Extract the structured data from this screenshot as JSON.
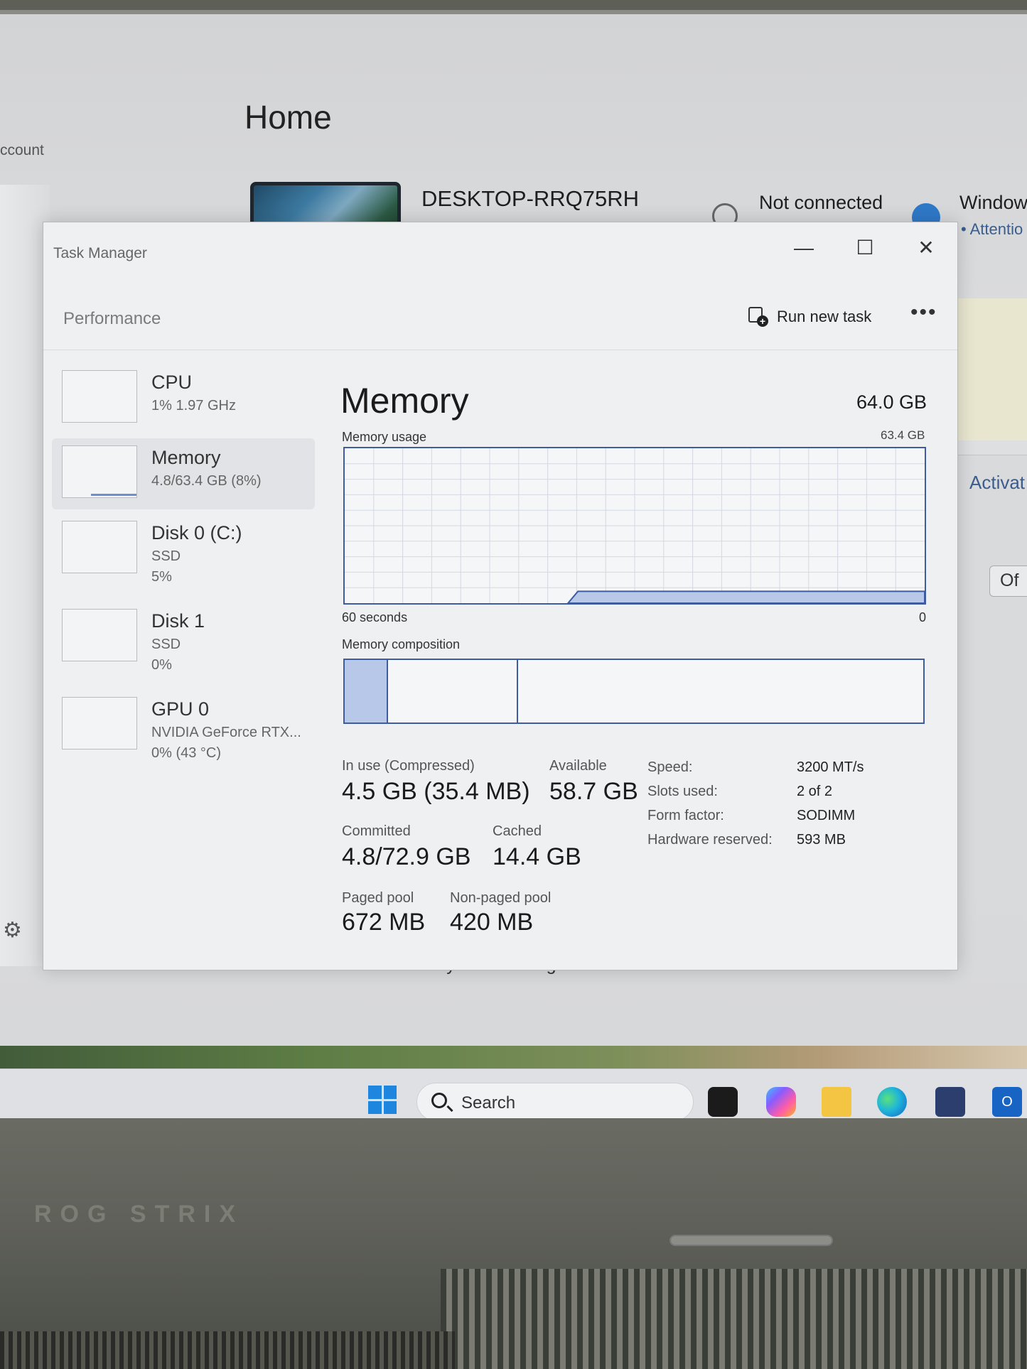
{
  "settings": {
    "title": "Home",
    "account_label": "ccount",
    "pc_name": "DESKTOP-RRQ75RH",
    "network_status": "Not connected",
    "windows_label": "Window",
    "attention_label": "• Attentio",
    "activate_label": "Activat",
    "off_label": "Of",
    "recent_label": "Recent and commonly used settings"
  },
  "task_manager": {
    "title": "Task Manager",
    "section": "Performance",
    "run_new_task": "Run new task",
    "more_label": "•••",
    "window_controls": {
      "minimize": "—",
      "maximize": "☐",
      "close": "✕"
    },
    "sidebar": [
      {
        "name": "CPU",
        "line1": "1%  1.97 GHz",
        "line2": ""
      },
      {
        "name": "Memory",
        "line1": "4.8/63.4 GB (8%)",
        "line2": ""
      },
      {
        "name": "Disk 0 (C:)",
        "line1": "SSD",
        "line2": "5%"
      },
      {
        "name": "Disk 1",
        "line1": "SSD",
        "line2": "0%"
      },
      {
        "name": "GPU 0",
        "line1": "NVIDIA GeForce RTX...",
        "line2": "0%  (43 °C)"
      }
    ],
    "selected_index": 1,
    "memory": {
      "title": "Memory",
      "total": "64.0 GB",
      "usage_label": "Memory usage",
      "usage_max": "63.4 GB",
      "time_left": "60 seconds",
      "time_right": "0",
      "composition_label": "Memory composition",
      "usage_fraction": 0.076,
      "composition": {
        "in_use_fraction": 0.075,
        "modified_end_fraction": 0.3
      },
      "stats": {
        "in_use_label": "In use (Compressed)",
        "in_use_value": "4.5 GB (35.4 MB)",
        "available_label": "Available",
        "available_value": "58.7 GB",
        "committed_label": "Committed",
        "committed_value": "4.8/72.9 GB",
        "cached_label": "Cached",
        "cached_value": "14.4 GB",
        "paged_label": "Paged pool",
        "paged_value": "672 MB",
        "nonpaged_label": "Non-paged pool",
        "nonpaged_value": "420 MB"
      },
      "specs": [
        {
          "label": "Speed:",
          "value": "3200 MT/s"
        },
        {
          "label": "Slots used:",
          "value": "2 of 2"
        },
        {
          "label": "Form factor:",
          "value": "SODIMM"
        },
        {
          "label": "Hardware reserved:",
          "value": "593 MB"
        }
      ]
    }
  },
  "taskbar": {
    "search_placeholder": "Search",
    "outlook_letter": "O"
  },
  "laptop": {
    "brand": "ROG STRIX"
  },
  "colors": {
    "graph_border": "#3f5ca0",
    "graph_fill": "#b7c8e8",
    "accent": "#1f86e0"
  }
}
